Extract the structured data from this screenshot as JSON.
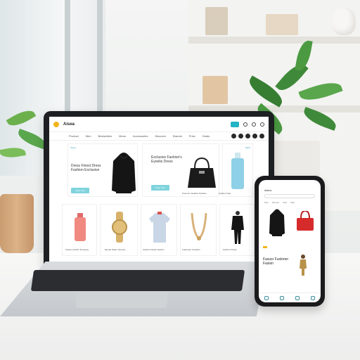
{
  "laptop": {
    "brand": "Aisea",
    "menu": [
      "Product",
      "Men",
      "Bestsellers",
      "Mens",
      "Accessories",
      "Discover",
      "Brands",
      "Price",
      "Deals"
    ],
    "promo_left": {
      "tag": "SALE",
      "headline": "Dress Finest Dress Fashion Exclusive",
      "button": "Shop Now"
    },
    "promo_mid": {
      "headline": "Exclusive Fashion's Eyeelis Dress",
      "button": "Shop Now"
    },
    "promo_right": {
      "tag": "NEW"
    },
    "captions_mid_row": [
      "Premium Faaliion Paistioo",
      "Fashion Ibiat"
    ],
    "captions_bottom_row": [
      "Fassion Duffer Shopping",
      "Elevati Fidlen Fanuton",
      "Fashion Deals Fashion",
      "Fraesslon Fussilios",
      "Fashion Prealt"
    ]
  },
  "phone": {
    "brand": "Aisea",
    "tabs": [
      "Men",
      "Women",
      "Kids",
      "Sale"
    ],
    "headline": "Fasusr Fusloner Fasion"
  },
  "colors": {
    "accent": "#22b3c4",
    "cta": "#7fd3dd",
    "brand_dot": "#f2b51b",
    "bag_red": "#d62b2b"
  }
}
